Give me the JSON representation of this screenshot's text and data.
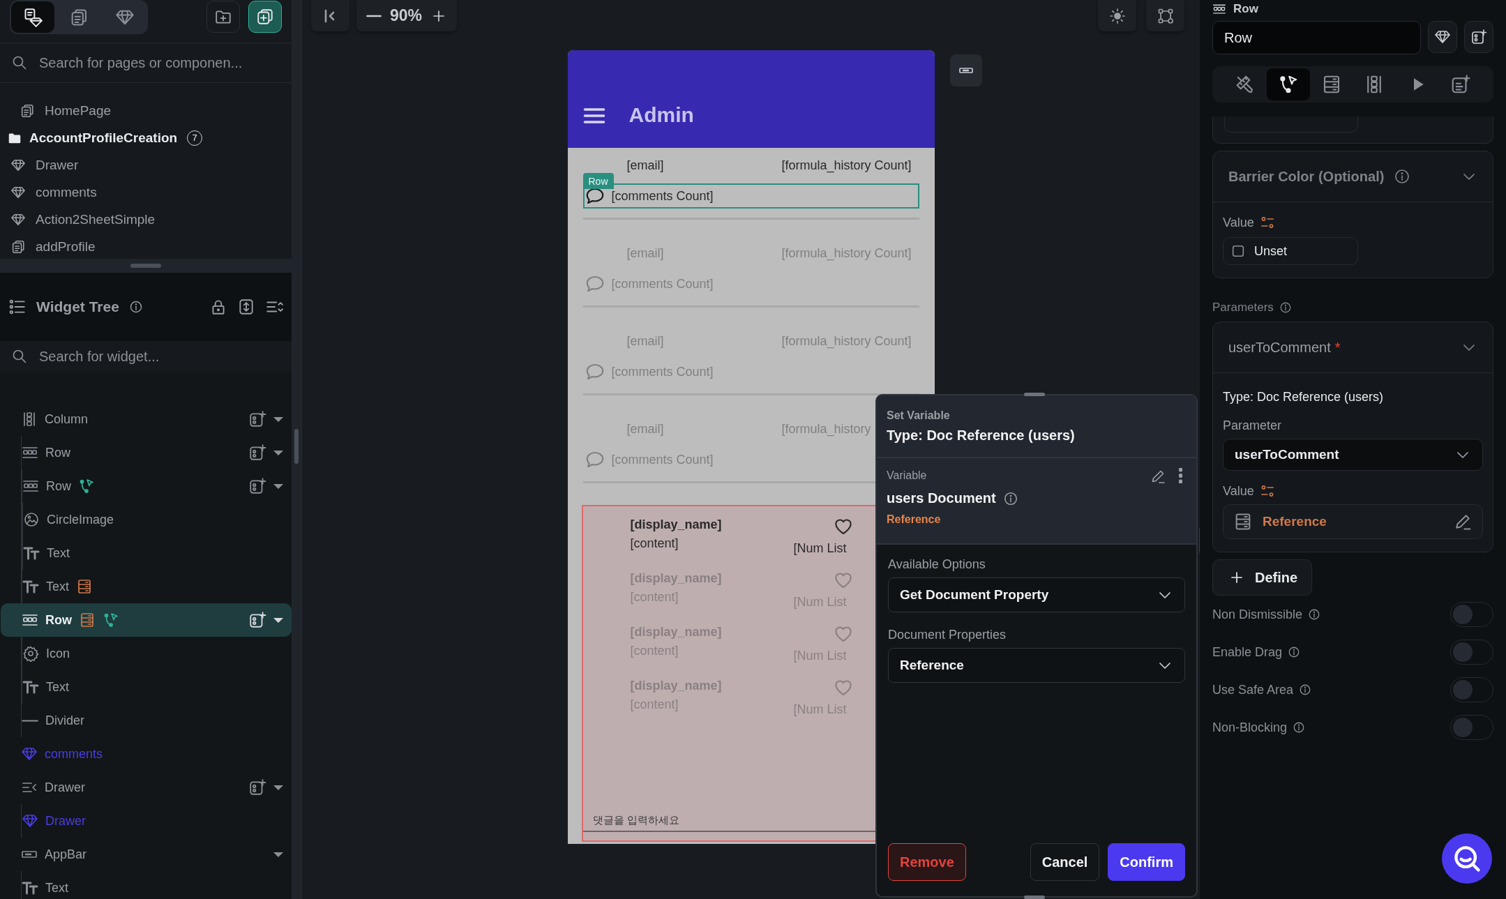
{
  "left_panel": {
    "mode_tabs": [
      {
        "kind": "pages-components",
        "selected": true
      },
      {
        "kind": "pages",
        "selected": false
      },
      {
        "kind": "components",
        "selected": false
      }
    ],
    "search": {
      "placeholder": "Search for pages or componen..."
    },
    "pages": [
      {
        "kind": "page",
        "label": "HomePage"
      },
      {
        "kind": "folder",
        "label": "AccountProfileCreation",
        "count": "7",
        "children": [
          {
            "kind": "component",
            "label": "Drawer"
          },
          {
            "kind": "component",
            "label": "comments"
          },
          {
            "kind": "component",
            "label": "Action2SheetSimple"
          },
          {
            "kind": "page",
            "label": "addProfile"
          }
        ]
      }
    ],
    "widget_tree": {
      "title": "Widget Tree",
      "search": {
        "placeholder": "Search for widget..."
      },
      "items": [
        {
          "kind": "column",
          "label": "Column",
          "selected": false,
          "query": false,
          "action": false,
          "add_button": true,
          "expandable": true,
          "children": [
            {
              "kind": "row",
              "label": "Row",
              "selected": false,
              "query": false,
              "action": false,
              "add_button": true,
              "expandable": true,
              "children": [
                {
                  "kind": "row",
                  "label": "Row",
                  "selected": false,
                  "query": false,
                  "action": true,
                  "add_button": true,
                  "expandable": true,
                  "children": [
                    {
                      "kind": "circle-image",
                      "label": "CircleImage",
                      "selected": false,
                      "query": false,
                      "action": false,
                      "add_button": false,
                      "expandable": false
                    },
                    {
                      "kind": "text",
                      "label": "Text",
                      "selected": false,
                      "query": false,
                      "action": false,
                      "add_button": false,
                      "expandable": false
                    }
                  ]
                },
                {
                  "kind": "text",
                  "label": "Text",
                  "selected": false,
                  "query": true,
                  "action": false,
                  "add_button": false,
                  "expandable": false
                }
              ]
            },
            {
              "kind": "row",
              "label": "Row",
              "selected": true,
              "query": true,
              "action": true,
              "add_button": true,
              "expandable": true,
              "children": [
                {
                  "kind": "icon",
                  "label": "Icon",
                  "selected": false,
                  "query": false,
                  "action": false,
                  "add_button": false,
                  "expandable": false
                },
                {
                  "kind": "text",
                  "label": "Text",
                  "selected": false,
                  "query": false,
                  "action": false,
                  "add_button": false,
                  "expandable": false
                }
              ]
            },
            {
              "kind": "divider",
              "label": "Divider",
              "selected": false,
              "query": false,
              "action": false,
              "add_button": false,
              "expandable": false
            }
          ]
        },
        {
          "kind": "component",
          "label": "comments",
          "selected": false,
          "query": false,
          "action": false,
          "add_button": false,
          "expandable": false
        },
        {
          "kind": "drawer",
          "label": "Drawer",
          "selected": false,
          "query": false,
          "action": false,
          "add_button": true,
          "expandable": true,
          "children": [
            {
              "kind": "component",
              "label": "Drawer",
              "selected": false,
              "query": false,
              "action": false,
              "add_button": false,
              "expandable": false
            }
          ]
        },
        {
          "kind": "appbar",
          "label": "AppBar",
          "selected": false,
          "query": false,
          "action": false,
          "add_button": false,
          "expandable": true,
          "children": [
            {
              "kind": "text",
              "label": "Text",
              "selected": false,
              "query": false,
              "action": false,
              "add_button": false,
              "expandable": false
            }
          ]
        }
      ]
    }
  },
  "canvas": {
    "zoom": "90%",
    "device": {
      "app_bar": {
        "title": "Admin"
      },
      "selection_label": "Row",
      "rows": [
        {
          "email": "[email]",
          "formula": "[formula_history Count]",
          "comments": "[comments Count]",
          "selected": true
        },
        {
          "email": "[email]",
          "formula": "[formula_history Count]",
          "comments": "[comments Count]",
          "selected": false
        },
        {
          "email": "[email]",
          "formula": "[formula_history Count]",
          "comments": "[comments Count]",
          "selected": false
        },
        {
          "email": "[email]",
          "formula": "[formula_history",
          "comments": "[comments Count]",
          "selected": false
        }
      ],
      "comments": {
        "items": [
          {
            "name": "[display_name]",
            "content": "[content]",
            "count": "[Num List",
            "dimmed": false
          },
          {
            "name": "[display_name]",
            "content": "[content]",
            "count": "[Num List",
            "dimmed": true
          },
          {
            "name": "[display_name]",
            "content": "[content]",
            "count": "[Num List",
            "dimmed": true
          },
          {
            "name": "[display_name]",
            "content": "[content]",
            "count": "[Num List",
            "dimmed": true
          }
        ],
        "input": {
          "placeholder": "댓글을 입력하세요"
        }
      }
    }
  },
  "set_variable_dialog": {
    "title": "Set Variable",
    "type": "Type: Doc Reference (users)",
    "variable": {
      "label": "Variable",
      "name": "users Document",
      "type": "Reference"
    },
    "fields": [
      {
        "label": "Available Options",
        "value": "Get Document Property"
      },
      {
        "label": "Document Properties",
        "value": "Reference"
      }
    ],
    "buttons": [
      {
        "kind": "danger",
        "label": "Remove"
      },
      {
        "kind": "secondary",
        "label": "Cancel"
      },
      {
        "kind": "primary",
        "label": "Confirm"
      }
    ]
  },
  "properties_panel": {
    "widget_type": "Row",
    "name_field": {
      "value": "Row"
    },
    "tabs": [
      {
        "kind": "design",
        "selected": false
      },
      {
        "kind": "actions",
        "selected": true
      },
      {
        "kind": "backend",
        "selected": false
      },
      {
        "kind": "layout",
        "selected": false
      },
      {
        "kind": "preview",
        "selected": false
      },
      {
        "kind": "notes",
        "selected": false
      }
    ],
    "barrier_color": {
      "title": "Barrier Color (Optional)",
      "value_label": "Value",
      "option": {
        "label": "Unset",
        "checked": false
      }
    },
    "parameters": {
      "title": "Parameters",
      "items": [
        {
          "name": "userToComment",
          "required_mark": "*",
          "type": "Type: Doc Reference (users)",
          "parameter_label": "Parameter",
          "parameter": "userToComment",
          "value_label": "Value",
          "value": "Reference"
        }
      ]
    },
    "define_button": "Define",
    "toggles": [
      {
        "label": "Non Dismissible",
        "on": false
      },
      {
        "label": "Enable Drag",
        "on": false
      },
      {
        "label": "Use Safe Area",
        "on": false
      },
      {
        "label": "Non-Blocking",
        "on": false
      }
    ]
  }
}
